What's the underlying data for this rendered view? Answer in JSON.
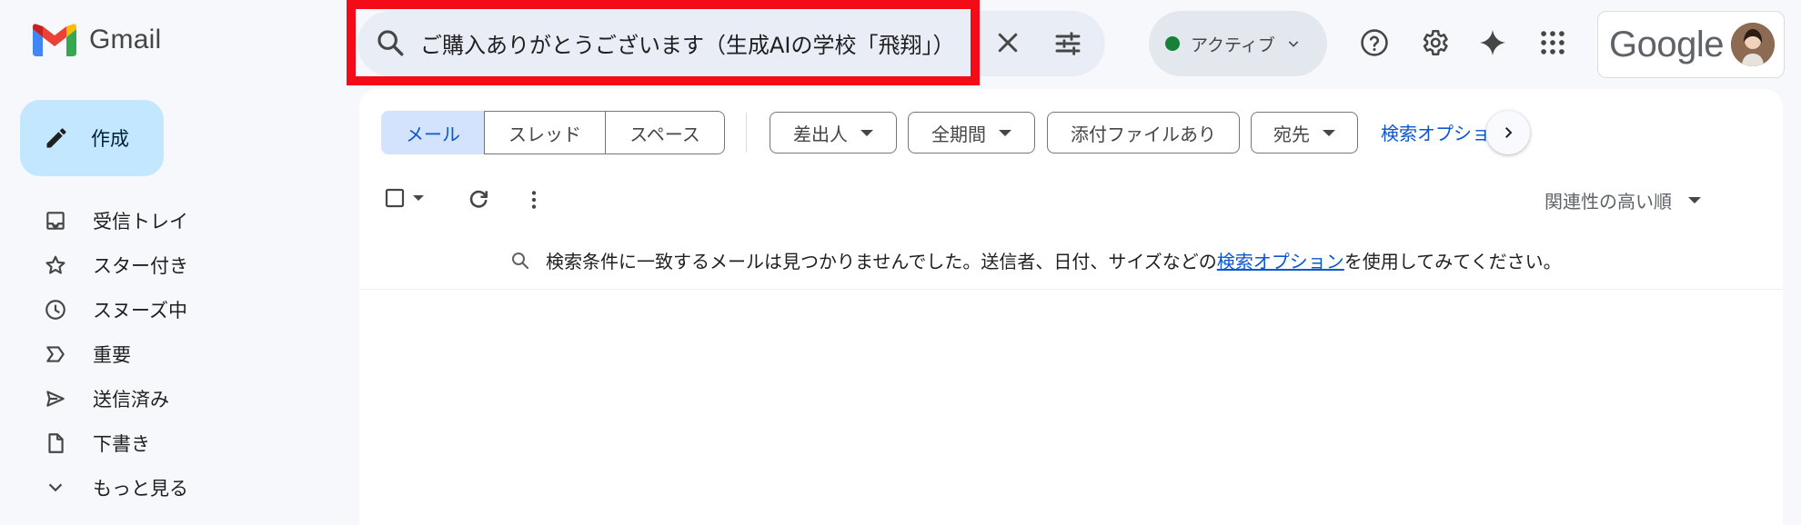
{
  "app": {
    "name": "Gmail"
  },
  "compose": {
    "label": "作成"
  },
  "sidebar": {
    "items": [
      {
        "label": "受信トレイ",
        "icon": "inbox-icon"
      },
      {
        "label": "スター付き",
        "icon": "star-icon"
      },
      {
        "label": "スヌーズ中",
        "icon": "clock-icon"
      },
      {
        "label": "重要",
        "icon": "important-icon"
      },
      {
        "label": "送信済み",
        "icon": "send-icon"
      },
      {
        "label": "下書き",
        "icon": "draft-icon"
      },
      {
        "label": "もっと見る",
        "icon": "chevron-down-icon"
      }
    ]
  },
  "search": {
    "value": "ご購入ありがとうございます（生成AIの学校「飛翔」）"
  },
  "status": {
    "label": "アクティブ"
  },
  "account": {
    "brand": "Google"
  },
  "filters": {
    "segments": [
      "メール",
      "スレッド",
      "スペース"
    ],
    "chips": [
      "差出人",
      "全期間",
      "添付ファイルあり",
      "宛先"
    ],
    "advanced_link": "検索オプション"
  },
  "list": {
    "sort_label": "関連性の高い順",
    "empty_prefix": "検索条件に一致するメールは見つかりませんでした。送信者、日付、サイズなどの",
    "empty_link": "検索オプション",
    "empty_suffix": "を使用してみてください。"
  },
  "colors": {
    "accent": "#0b57d0",
    "compose_bg": "#c2e7ff",
    "highlight_border": "#f30b17",
    "status_dot": "#188038"
  }
}
